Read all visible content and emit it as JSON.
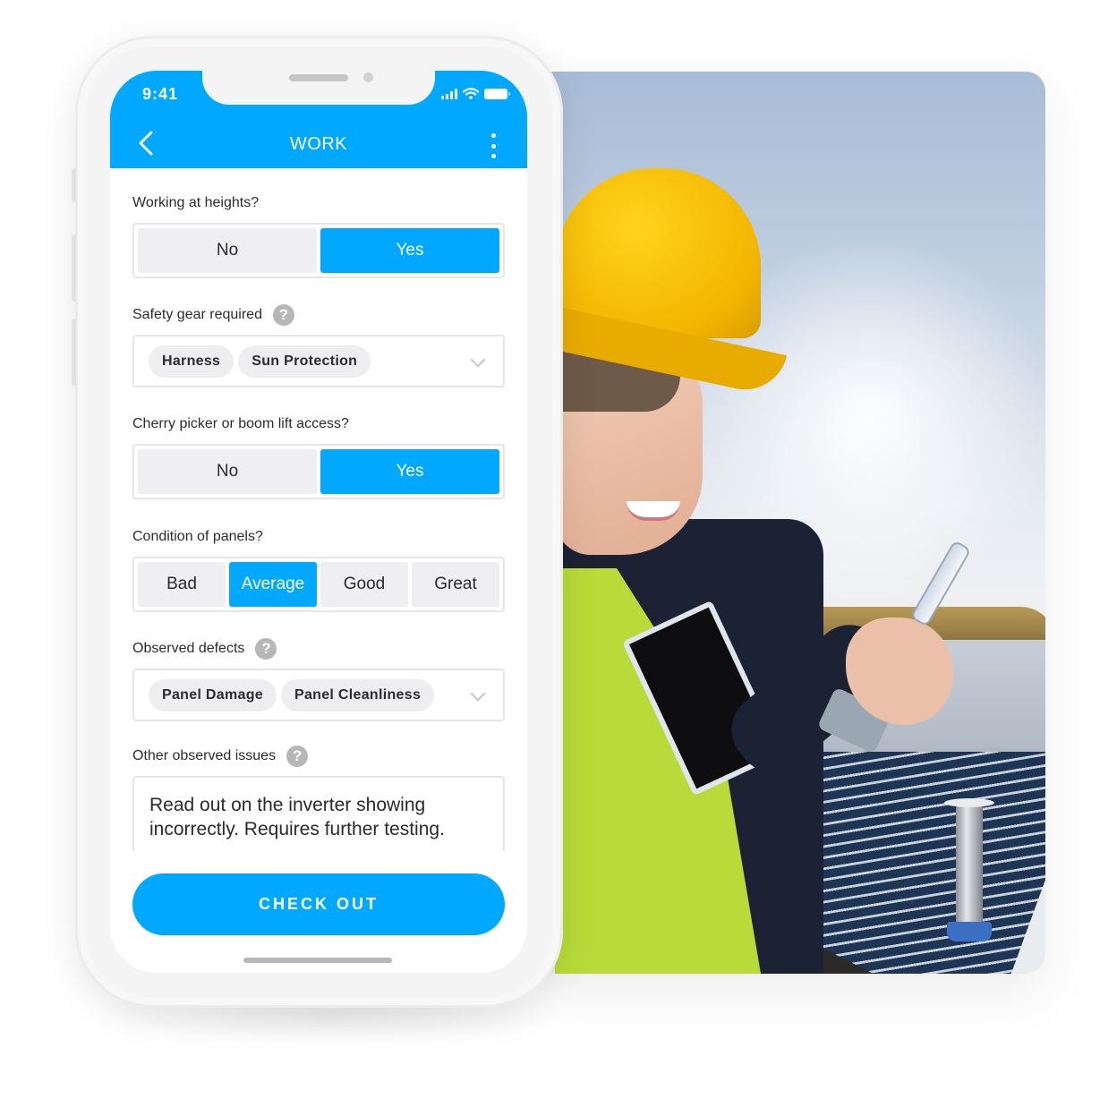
{
  "colors": {
    "accent": "#00a8ff",
    "chip_bg": "#eeeef0",
    "segment_bg": "#efeff1",
    "help_icon": "#b7b7b7"
  },
  "status_bar": {
    "time": "9:41",
    "icons": [
      "signal-icon",
      "wifi-icon",
      "battery-icon"
    ]
  },
  "app_bar": {
    "title": "WORK",
    "back_icon": "chevron-left-icon",
    "menu_icon": "more-vertical-icon"
  },
  "form": {
    "working_at_heights": {
      "label": "Working at heights?",
      "options": [
        "No",
        "Yes"
      ],
      "selected": "Yes"
    },
    "safety_gear": {
      "label": "Safety gear required",
      "help": "?",
      "chips": [
        "Harness",
        "Sun Protection"
      ]
    },
    "cherry_picker": {
      "label": "Cherry picker or boom lift access?",
      "options": [
        "No",
        "Yes"
      ],
      "selected": "Yes"
    },
    "panel_condition": {
      "label": "Condition of panels?",
      "options": [
        "Bad",
        "Average",
        "Good",
        "Great"
      ],
      "selected": "Average"
    },
    "observed_defects": {
      "label": "Observed defects",
      "help": "?",
      "chips": [
        "Panel Damage",
        "Panel Cleanliness"
      ]
    },
    "other_issues": {
      "label": "Other observed issues",
      "help": "?",
      "value": "Read out on the inverter showing incorrectly. Requires further testing."
    }
  },
  "cta": {
    "label": "CHECK OUT"
  },
  "photo": {
    "description": "Smiling worker in yellow hard hat and hi-vis vest using a phone on a rooftop with solar panels"
  }
}
